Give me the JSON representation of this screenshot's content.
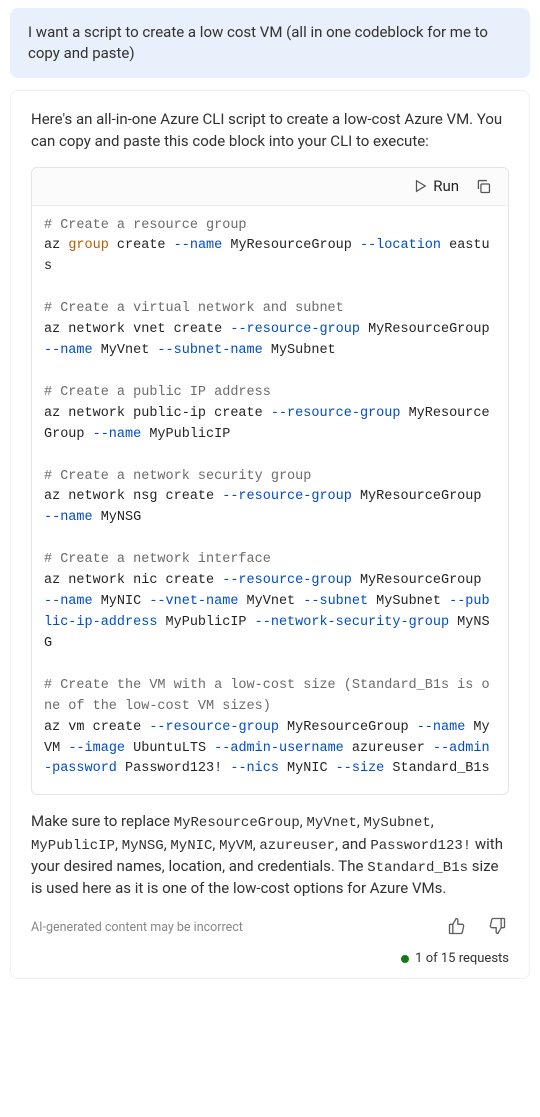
{
  "user_message": "I want a script to create a low cost VM (all in one codeblock for me to copy and paste)",
  "assistant_intro": "Here's an all-in-one Azure CLI script to create a low-cost Azure VM. You can copy and paste this code block into your CLI to execute:",
  "code_toolbar": {
    "run_label": "Run"
  },
  "code": {
    "s1_comment": "# Create a resource group",
    "s1_l1a": "az ",
    "s1_l1_kw": "group",
    "s1_l1b": " create ",
    "s1_l1_f1": "--name",
    "s1_l1c": " MyResourceGroup ",
    "s1_l1_f2": "--location",
    "s1_l1d": " eastus",
    "s2_comment": "# Create a virtual network and subnet",
    "s2_l1a": "az network vnet create ",
    "s2_l1_f1": "--resource-group",
    "s2_l1b": " MyResourceGroup ",
    "s2_l1_f2": "--name",
    "s2_l1c": " MyVnet ",
    "s2_l1_f3": "--subnet-name",
    "s2_l1d": " MySubnet",
    "s3_comment": "# Create a public IP address",
    "s3_l1a": "az network public-ip create ",
    "s3_l1_f1": "--resource-group",
    "s3_l1b": " MyResourceGroup ",
    "s3_l1_f2": "--name",
    "s3_l1c": " MyPublicIP",
    "s4_comment": "# Create a network security group",
    "s4_l1a": "az network nsg create ",
    "s4_l1_f1": "--resource-group",
    "s4_l1b": " MyResourceGroup ",
    "s4_l1_f2": "--name",
    "s4_l1c": " MyNSG",
    "s5_comment": "# Create a network interface",
    "s5_l1a": "az network nic create ",
    "s5_l1_f1": "--resource-group",
    "s5_l1b": " MyResourceGroup ",
    "s5_l1_f2": "--name",
    "s5_l1c": " MyNIC ",
    "s5_l1_f3": "--vnet-name",
    "s5_l1d": " MyVnet ",
    "s5_l1_f4": "--subnet",
    "s5_l1e": " MySubnet ",
    "s5_l1_f5": "--public-ip-address",
    "s5_l1f": " MyPublicIP ",
    "s5_l1_f6": "--network-security-group",
    "s5_l1g": " MyNSG",
    "s6_comment": "# Create the VM with a low-cost size (Standard_B1s is one of the low-cost VM sizes)",
    "s6_l1a": "az vm create ",
    "s6_l1_f1": "--resource-group",
    "s6_l1b": " MyResourceGroup ",
    "s6_l1_f2": "--name",
    "s6_l1c": " MyVM ",
    "s6_l1_f3": "--image",
    "s6_l1d": " UbuntuLTS ",
    "s6_l1_f4": "--admin-username",
    "s6_l1e": " azureuser ",
    "s6_l1_f5": "--admin-password",
    "s6_l1f": " Password123! ",
    "s6_l1_f6": "--nics",
    "s6_l1g": " MyNIC ",
    "s6_l1_f7": "--size",
    "s6_l1h": " Standard_B1s"
  },
  "followup": {
    "p1a": "Make sure to replace ",
    "c1": "MyResourceGroup",
    "p1b": ", ",
    "c2": "MyVnet",
    "p1c": ", ",
    "c3": "MySubnet",
    "p1d": ", ",
    "c4": "MyPublicIP",
    "p1e": ", ",
    "c5": "MyNSG",
    "p1f": ", ",
    "c6": "MyNIC",
    "p1g": ", ",
    "c7": "MyVM",
    "p1h": ", ",
    "c8": "azureuser",
    "p1i": ", and ",
    "c9": "Password123!",
    "p1j": " with your desired names, location, and credentials. The ",
    "c10": "Standard_B1s",
    "p1k": " size is used here as it is one of the low-cost options for Azure VMs."
  },
  "disclaimer": "AI-generated content may be incorrect",
  "requests_text": "1 of 15 requests"
}
